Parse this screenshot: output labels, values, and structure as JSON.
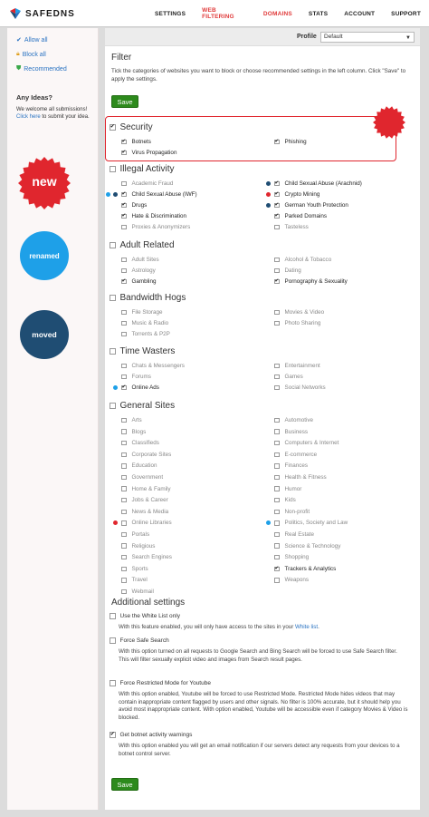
{
  "brand": {
    "name": "SAFEDNS"
  },
  "nav": [
    {
      "label": "SETTINGS",
      "active": false
    },
    {
      "label": "WEB FILTERING",
      "active": true
    },
    {
      "label": "DOMAINS",
      "active": true
    },
    {
      "label": "STATS",
      "active": false
    },
    {
      "label": "ACCOUNT",
      "active": false
    },
    {
      "label": "SUPPORT",
      "active": false
    }
  ],
  "sidebar": {
    "links": [
      {
        "label": "Allow all",
        "icon": "check-icon",
        "color": "#2a73c2"
      },
      {
        "label": "Block all",
        "icon": "lock-icon",
        "color": "#e0a020"
      },
      {
        "label": "Recommended",
        "icon": "shield-icon",
        "color": "#3aa84a"
      }
    ],
    "ideas_title": "Any Ideas?",
    "ideas_text": "We welcome all submissions!",
    "ideas_link": "Click here",
    "ideas_suffix": " to submit your idea.",
    "badges": [
      {
        "label": "new",
        "color": "#e0262e"
      },
      {
        "label": "renamed",
        "color": "#1ea0e8"
      },
      {
        "label": "moved",
        "color": "#1f4d73"
      }
    ]
  },
  "profile": {
    "label": "Profile",
    "selected": "Default"
  },
  "filter": {
    "title": "Filter",
    "description": "Tick the categories of websites you want to block or choose recommended settings in the left column. Click \"Save\" to apply the settings.",
    "save_label": "Save"
  },
  "colors": {
    "new": "#e0262e",
    "renamed": "#1ea0e8",
    "moved": "#1f4d73",
    "accent": "#e03b3b",
    "save": "#2d8a1c"
  },
  "categories": [
    {
      "name": "Security",
      "checked": true,
      "items": [
        {
          "label": "Botnets",
          "checked": true,
          "dot": null
        },
        {
          "label": "Phishing",
          "checked": true,
          "dot": null
        },
        {
          "label": "Virus Propagation",
          "checked": true,
          "dot": null
        }
      ]
    },
    {
      "name": "Illegal Activity",
      "checked": false,
      "items": [
        {
          "label": "Academic Fraud",
          "checked": false,
          "dot": null
        },
        {
          "label": "Child Sexual Abuse (Arachnid)",
          "checked": true,
          "dot": "moved"
        },
        {
          "label": "Child Sexual Abuse (IWF)",
          "checked": true,
          "dot": "renamed+moved"
        },
        {
          "label": "Crypto Mining",
          "checked": true,
          "dot": "new"
        },
        {
          "label": "Drugs",
          "checked": true,
          "dot": null
        },
        {
          "label": "German Youth Protection",
          "checked": true,
          "dot": "moved"
        },
        {
          "label": "Hate & Discrimination",
          "checked": true,
          "dot": null
        },
        {
          "label": "Parked Domains",
          "checked": true,
          "dot": null
        },
        {
          "label": "Proxies & Anonymizers",
          "checked": false,
          "dot": null
        },
        {
          "label": "Tasteless",
          "checked": false,
          "dot": null
        }
      ]
    },
    {
      "name": "Adult Related",
      "checked": false,
      "items": [
        {
          "label": "Adult Sites",
          "checked": false,
          "dot": null
        },
        {
          "label": "Alcohol & Tobacco",
          "checked": false,
          "dot": null
        },
        {
          "label": "Astrology",
          "checked": false,
          "dot": null
        },
        {
          "label": "Dating",
          "checked": false,
          "dot": null
        },
        {
          "label": "Gambling",
          "checked": true,
          "dot": null
        },
        {
          "label": "Pornography & Sexuality",
          "checked": true,
          "dot": null
        }
      ]
    },
    {
      "name": "Bandwidth Hogs",
      "checked": false,
      "items": [
        {
          "label": "File Storage",
          "checked": false,
          "dot": null
        },
        {
          "label": "Movies & Video",
          "checked": false,
          "dot": null
        },
        {
          "label": "Music & Radio",
          "checked": false,
          "dot": null
        },
        {
          "label": "Photo Sharing",
          "checked": false,
          "dot": null
        },
        {
          "label": "Torrents & P2P",
          "checked": false,
          "dot": null
        }
      ]
    },
    {
      "name": "Time Wasters",
      "checked": false,
      "items": [
        {
          "label": "Chats & Messengers",
          "checked": false,
          "dot": null
        },
        {
          "label": "Entertainment",
          "checked": false,
          "dot": null
        },
        {
          "label": "Forums",
          "checked": false,
          "dot": null
        },
        {
          "label": "Games",
          "checked": false,
          "dot": null
        },
        {
          "label": "Online Ads",
          "checked": true,
          "dot": "renamed"
        },
        {
          "label": "Social Networks",
          "checked": false,
          "dot": null
        }
      ]
    },
    {
      "name": "General Sites",
      "checked": false,
      "items": [
        {
          "label": "Arts",
          "checked": false,
          "dot": null
        },
        {
          "label": "Automotive",
          "checked": false,
          "dot": null
        },
        {
          "label": "Blogs",
          "checked": false,
          "dot": null
        },
        {
          "label": "Business",
          "checked": false,
          "dot": null
        },
        {
          "label": "Classifieds",
          "checked": false,
          "dot": null
        },
        {
          "label": "Computers & Internet",
          "checked": false,
          "dot": null
        },
        {
          "label": "Corporate Sites",
          "checked": false,
          "dot": null
        },
        {
          "label": "E-commerce",
          "checked": false,
          "dot": null
        },
        {
          "label": "Education",
          "checked": false,
          "dot": null
        },
        {
          "label": "Finances",
          "checked": false,
          "dot": null
        },
        {
          "label": "Government",
          "checked": false,
          "dot": null
        },
        {
          "label": "Health & Fitness",
          "checked": false,
          "dot": null
        },
        {
          "label": "Home & Family",
          "checked": false,
          "dot": null
        },
        {
          "label": "Humor",
          "checked": false,
          "dot": null
        },
        {
          "label": "Jobs & Career",
          "checked": false,
          "dot": null
        },
        {
          "label": "Kids",
          "checked": false,
          "dot": null
        },
        {
          "label": "News & Media",
          "checked": false,
          "dot": null
        },
        {
          "label": "Non-profit",
          "checked": false,
          "dot": null
        },
        {
          "label": "Online Libraries",
          "checked": false,
          "dot": "new"
        },
        {
          "label": "Politics, Society and Law",
          "checked": false,
          "dot": "renamed"
        },
        {
          "label": "Portals",
          "checked": false,
          "dot": null
        },
        {
          "label": "Real Estate",
          "checked": false,
          "dot": null
        },
        {
          "label": "Religious",
          "checked": false,
          "dot": null
        },
        {
          "label": "Science & Technology",
          "checked": false,
          "dot": null
        },
        {
          "label": "Search Engines",
          "checked": false,
          "dot": null
        },
        {
          "label": "Shopping",
          "checked": false,
          "dot": null
        },
        {
          "label": "Sports",
          "checked": false,
          "dot": null
        },
        {
          "label": "Trackers & Analytics",
          "checked": true,
          "dot": null
        },
        {
          "label": "Travel",
          "checked": false,
          "dot": null
        },
        {
          "label": "Weapons",
          "checked": false,
          "dot": null
        },
        {
          "label": "Webmail",
          "checked": false,
          "dot": null
        }
      ]
    }
  ],
  "additional": {
    "title": "Additional settings",
    "settings": [
      {
        "label": "Use the White List only",
        "checked": false,
        "desc": "With this feature enabled, you will only have access to the sites in your ",
        "link": "White list",
        "desc_suffix": "."
      },
      {
        "label": "Force Safe Search",
        "checked": false,
        "desc": "With this option turned on all requests to Google Search and Bing Search will be forced to use Safe Search filter.",
        "desc2": "This will filter sexually explicit video and images from Search result pages."
      },
      {
        "label": "Force Restricted Mode for Youtube",
        "checked": false,
        "desc": "With this option enabled, Youtube will be forced to use Restricted Mode. Restricted Mode hides videos that may contain inappropriate content flagged by users and other signals. No filter is 100% accurate, but it should help you avoid most inappropriate content. With option enabled, Youtube will be accessible even if category Movies & Video is blocked."
      },
      {
        "label": "Get botnet activity warnings",
        "checked": true,
        "desc": "With this option enabled you will get an email notification if our servers detect any requests from your devices to a botnet control server."
      }
    ],
    "save_label": "Save"
  }
}
